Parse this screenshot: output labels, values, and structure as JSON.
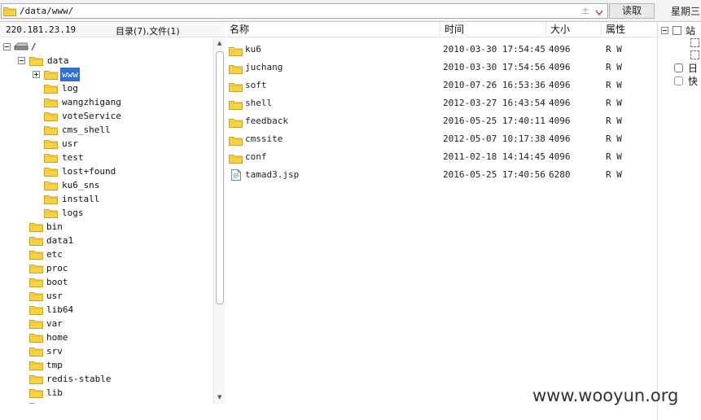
{
  "address_bar": {
    "path": "/data/www/",
    "plus_label": "±"
  },
  "read_button": "读取",
  "weekday": "星期三",
  "left_header": {
    "ip": "220.181.23.19",
    "counts": "目录(7),文件(1)"
  },
  "tree": {
    "root": "/",
    "data": "data",
    "data_children": [
      "www",
      "log",
      "wangzhigang",
      "voteService",
      "cms_shell",
      "usr",
      "test",
      "lost+found",
      "ku6_sns",
      "install",
      "logs"
    ],
    "root_children": [
      "bin",
      "data1",
      "etc",
      "proc",
      "boot",
      "usr",
      "lib64",
      "var",
      "home",
      "srv",
      "tmp",
      "redis-stable",
      "lib"
    ],
    "selected": "www"
  },
  "columns": {
    "name": "名称",
    "time": "时间",
    "size": "大小",
    "attr": "属性"
  },
  "files": [
    {
      "name": "ku6",
      "time": "2010-03-30 17:54:45",
      "size": "4096",
      "attr": "R W",
      "type": "folder"
    },
    {
      "name": "juchang",
      "time": "2010-03-30 17:54:56",
      "size": "4096",
      "attr": "R W",
      "type": "folder"
    },
    {
      "name": "soft",
      "time": "2010-07-26 16:53:36",
      "size": "4096",
      "attr": "R W",
      "type": "folder"
    },
    {
      "name": "shell",
      "time": "2012-03-27 16:43:54",
      "size": "4096",
      "attr": "R W",
      "type": "folder"
    },
    {
      "name": "feedback",
      "time": "2016-05-25 17:40:11",
      "size": "4096",
      "attr": "R W",
      "type": "folder"
    },
    {
      "name": "cmssite",
      "time": "2012-05-07 10:17:38",
      "size": "4096",
      "attr": "R W",
      "type": "folder"
    },
    {
      "name": "conf",
      "time": "2011-02-18 14:14:45",
      "size": "4096",
      "attr": "R W",
      "type": "folder"
    },
    {
      "name": "tamad3.jsp",
      "time": "2016-05-25 17:40:56",
      "size": "6280",
      "attr": "R W",
      "type": "file"
    }
  ],
  "right_panel": {
    "item1": "站",
    "item2": "日",
    "item3": "快"
  },
  "watermark": "www.wooyun.org",
  "colors": {
    "folder": "#f6d24a",
    "folder_edge": "#c9a227",
    "selection": "#2f6fd6"
  }
}
